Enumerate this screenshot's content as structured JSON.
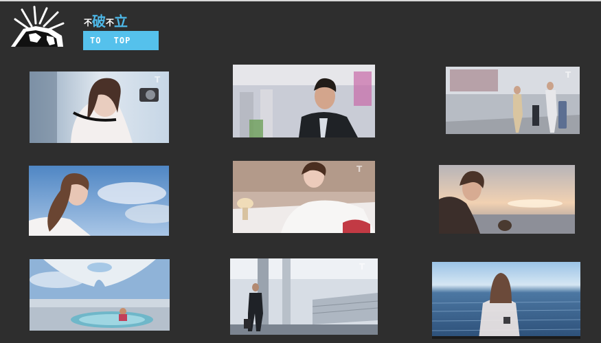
{
  "header": {
    "brand": [
      "不",
      "破",
      "不",
      "立"
    ],
    "to_top_label": "TO TOP"
  },
  "gallery": {
    "watermark": "T",
    "items": [
      {
        "scene": "woman-with-camera"
      },
      {
        "scene": "man-in-suit-terminal"
      },
      {
        "scene": "family-walking-terminal"
      },
      {
        "scene": "woman-looking-up-sky"
      },
      {
        "scene": "woman-writing-on-bed"
      },
      {
        "scene": "woman-at-sunset"
      },
      {
        "scene": "ship-deck-hot-tub"
      },
      {
        "scene": "man-walking-with-luggage"
      },
      {
        "scene": "woman-facing-ocean"
      }
    ]
  }
}
